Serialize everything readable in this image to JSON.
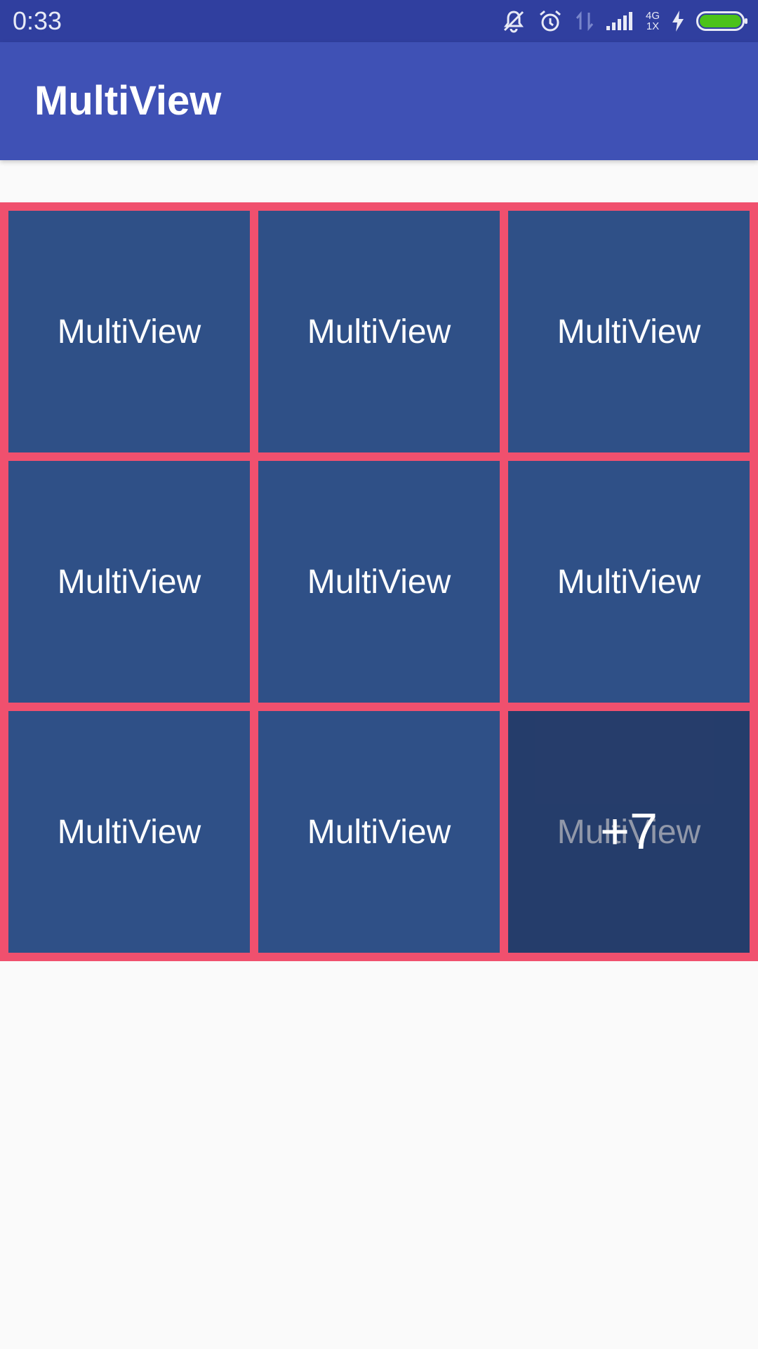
{
  "status_bar": {
    "time": "0:33",
    "network_top": "4G",
    "network_bottom": "1X",
    "icons": [
      "notifications-off-icon",
      "alarm-icon",
      "data-arrows-icon",
      "signal-icon",
      "signal-icon",
      "charging-icon",
      "battery-icon"
    ],
    "battery_color": "#4cc21a"
  },
  "app_bar": {
    "title": "MultiView",
    "color": "#3f51b5"
  },
  "grid": {
    "border_color": "#f0506e",
    "cell_color": "#2f5087",
    "cells": [
      {
        "label": "MultiView"
      },
      {
        "label": "MultiView"
      },
      {
        "label": "MultiView"
      },
      {
        "label": "MultiView"
      },
      {
        "label": "MultiView"
      },
      {
        "label": "MultiView"
      },
      {
        "label": "MultiView"
      },
      {
        "label": "MultiView"
      },
      {
        "label": "MultiView",
        "more": "+7"
      }
    ]
  }
}
